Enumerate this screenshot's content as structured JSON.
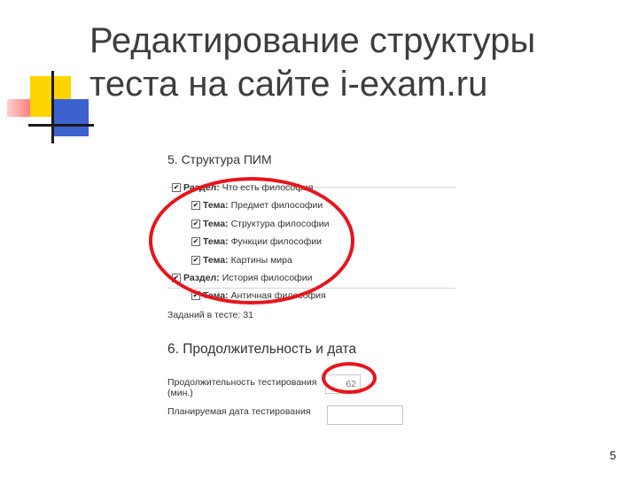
{
  "slide": {
    "title_line1": "Редактирование структуры",
    "title_line2": "теста на сайте i-exam.ru",
    "page_number": "5"
  },
  "structure_section": {
    "heading": "5. Структура ПИМ",
    "items": [
      {
        "kind": "Раздел:",
        "text": "Что есть философия",
        "checked": true
      },
      {
        "kind": "Тема:",
        "text": "Предмет философии",
        "checked": true
      },
      {
        "kind": "Тема:",
        "text": "Структура философии",
        "checked": true
      },
      {
        "kind": "Тема:",
        "text": "Функции философии",
        "checked": true
      },
      {
        "kind": "Тема:",
        "text": "Картины мира",
        "checked": true
      },
      {
        "kind": "Раздел:",
        "text": "История философии",
        "checked": true
      },
      {
        "kind": "Тема:",
        "text": "Античная философия",
        "checked": true
      }
    ],
    "tasks_count_label": "Заданий в тесте: 31"
  },
  "duration_section": {
    "heading": "6. Продолжительность и дата",
    "duration_label_line1": "Продолжительность тестирования",
    "duration_label_line2": "(мин.)",
    "duration_value": "62",
    "date_label": "Планируемая дата тестирования",
    "date_value": ""
  },
  "colors": {
    "annotation_red": "#e8141c",
    "title_gray": "#3d3d3d",
    "deco_yellow": "#ffd400",
    "deco_blue": "#3c62cf"
  }
}
